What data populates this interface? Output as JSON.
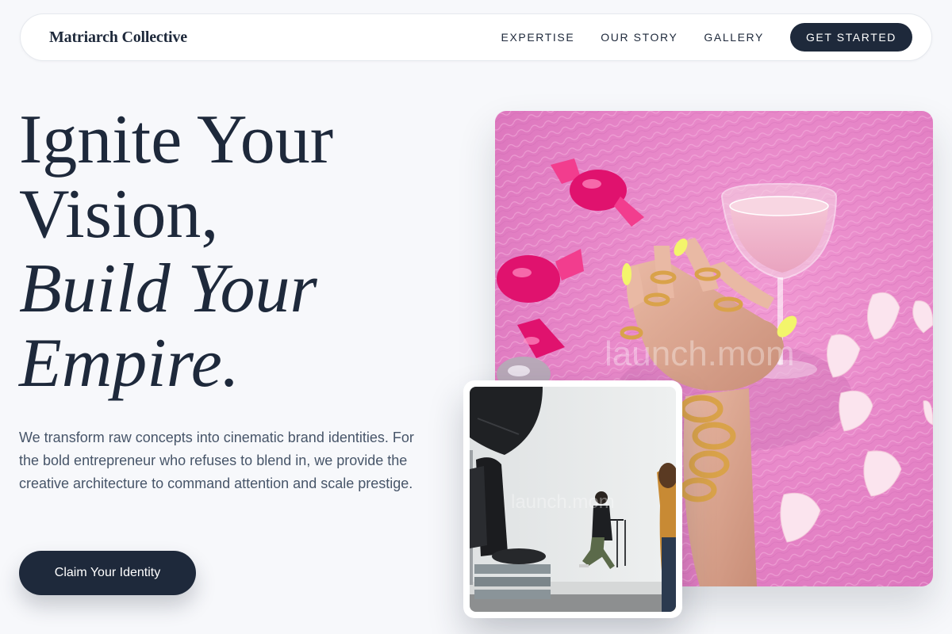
{
  "nav": {
    "brand": "Matriarch Collective",
    "links": [
      "EXPERTISE",
      "OUR STORY",
      "GALLERY"
    ],
    "cta": "GET STARTED"
  },
  "hero": {
    "headline": {
      "line1": "Ignite Your",
      "line2": "Vision,",
      "line3": "Build Your",
      "line4": "Empire."
    },
    "subcopy": "We transform raw concepts into cinematic brand identities. For the bold entrepreneur who refuses to blend in, we provide the creative architecture to command attention and scale prestige.",
    "cta": "Claim Your Identity"
  },
  "images": {
    "main_watermark": "launch.mom",
    "inset_watermark": "launch.mom"
  },
  "colors": {
    "primary": "#1e293b",
    "background": "#f7f8fb",
    "body_text": "#475569",
    "fur_pink": "#e889c8",
    "candy_magenta": "#e0126e"
  }
}
